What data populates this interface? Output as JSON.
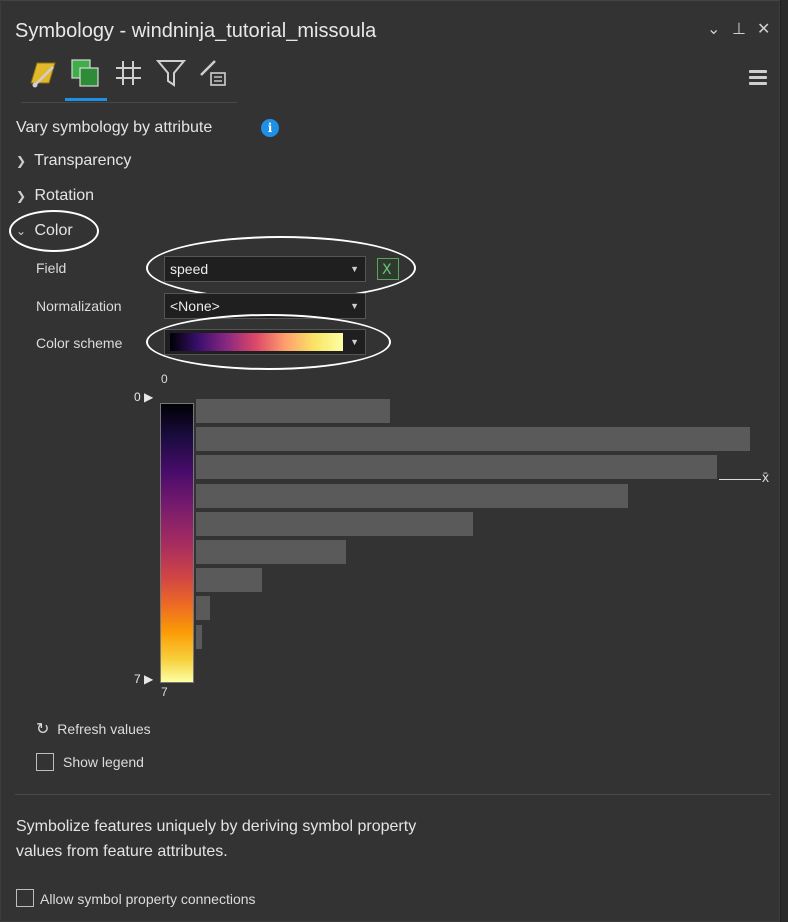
{
  "window": {
    "title": "Symbology - windninja_tutorial_missoula",
    "controls": {
      "dropdown": "⌄",
      "pin": "⊥",
      "close": "✕"
    }
  },
  "tabs": [
    {
      "name": "primary-symbology",
      "icon": "brush-polygon-icon"
    },
    {
      "name": "vary-by-attribute",
      "icon": "green-squares-icon",
      "selected": true
    },
    {
      "name": "symbol-layers",
      "icon": "hash-grid-icon"
    },
    {
      "name": "symbol-filter",
      "icon": "funnel-icon"
    },
    {
      "name": "attribute-driven",
      "icon": "pen-list-icon"
    }
  ],
  "heading": "Vary symbology by attribute",
  "sections": {
    "transparency": "Transparency",
    "rotation": "Rotation",
    "color": "Color"
  },
  "color": {
    "field_label": "Field",
    "field_value": "speed",
    "normalization_label": "Normalization",
    "normalization_value": "<None>",
    "scheme_label": "Color scheme",
    "ramp_min": "0",
    "ramp_max": "7",
    "handle_min": "0",
    "handle_max": "7",
    "mean_label": "x̄"
  },
  "histogram": {
    "bin_counts_relative": [
      0.35,
      1.0,
      0.94,
      0.78,
      0.5,
      0.27,
      0.12,
      0.025,
      0.01
    ]
  },
  "actions": {
    "refresh": "Refresh values",
    "show_legend": "Show legend",
    "allow_connections": "Allow symbol property connections"
  },
  "description": "Symbolize features uniquely by deriving symbol property values from feature attributes.",
  "colors": {
    "accent": "#1e90e6",
    "background": "#333333",
    "bar": "#5a5a5a"
  }
}
